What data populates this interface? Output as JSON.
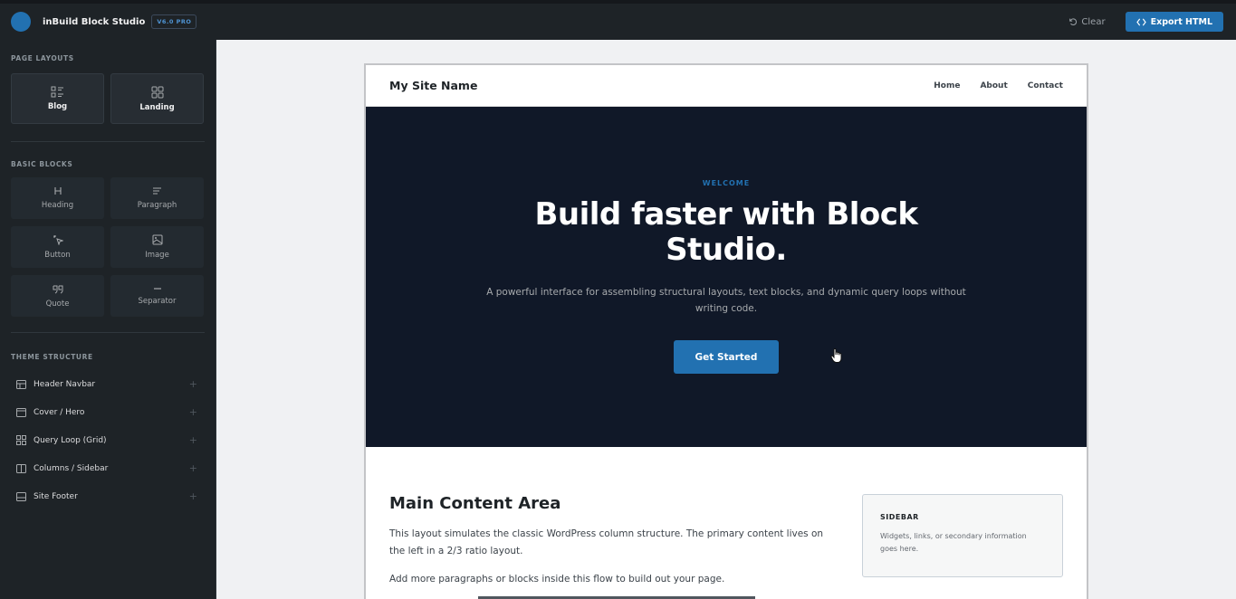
{
  "app": {
    "title": "inBuild Block Studio",
    "version": "V6.0 PRO",
    "clear_label": "Clear",
    "export_label": "Export HTML",
    "accent": "#2271b1"
  },
  "sidebar": {
    "page_layouts_title": "PAGE LAYOUTS",
    "layouts": [
      {
        "label": "Blog",
        "icon": "blog-layout-icon"
      },
      {
        "label": "Landing",
        "icon": "landing-layout-icon"
      }
    ],
    "basic_blocks_title": "BASIC BLOCKS",
    "blocks": [
      {
        "label": "Heading",
        "icon": "heading-icon"
      },
      {
        "label": "Paragraph",
        "icon": "paragraph-icon"
      },
      {
        "label": "Button",
        "icon": "button-icon"
      },
      {
        "label": "Image",
        "icon": "image-icon"
      },
      {
        "label": "Quote",
        "icon": "quote-icon"
      },
      {
        "label": "Separator",
        "icon": "separator-icon"
      }
    ],
    "theme_structure_title": "THEME STRUCTURE",
    "structure": [
      {
        "label": "Header Navbar",
        "icon": "header-navbar-icon"
      },
      {
        "label": "Cover / Hero",
        "icon": "cover-hero-icon"
      },
      {
        "label": "Query Loop (Grid)",
        "icon": "query-loop-icon"
      },
      {
        "label": "Columns / Sidebar",
        "icon": "columns-icon"
      },
      {
        "label": "Site Footer",
        "icon": "site-footer-icon"
      }
    ]
  },
  "canvas": {
    "site_name": "My Site Name",
    "nav": [
      "Home",
      "About",
      "Contact"
    ],
    "hero": {
      "eyebrow": "WELCOME",
      "title": "Build faster with Block Studio.",
      "subtitle": "A powerful interface for assembling structural layouts, text blocks, and dynamic query loops without writing code.",
      "button": "Get Started"
    },
    "main": {
      "title": "Main Content Area",
      "p1": "This layout simulates the classic WordPress column structure. The primary content lives on the left in a 2/3 ratio layout.",
      "p2": "Add more paragraphs or blocks inside this flow to build out your page."
    },
    "sidebar": {
      "title": "SIDEBAR",
      "text": "Widgets, links, or secondary information goes here."
    }
  }
}
